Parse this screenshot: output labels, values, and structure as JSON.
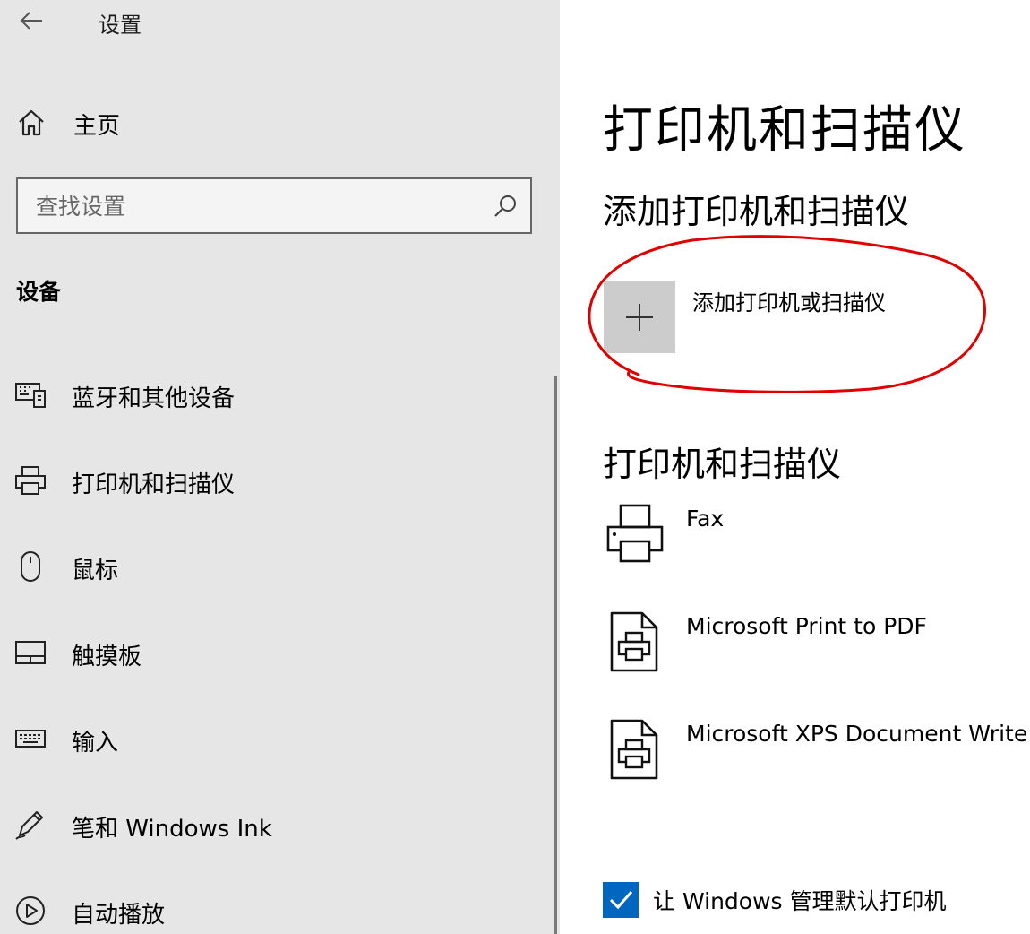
{
  "window": {
    "title": "设置"
  },
  "sidebar": {
    "home_label": "主页",
    "search_placeholder": "查找设置",
    "section_title": "设备",
    "items": [
      {
        "label": "蓝牙和其他设备",
        "icon": "bluetooth-devices-icon"
      },
      {
        "label": "打印机和扫描仪",
        "icon": "printer-icon"
      },
      {
        "label": "鼠标",
        "icon": "mouse-icon"
      },
      {
        "label": "触摸板",
        "icon": "touchpad-icon"
      },
      {
        "label": "输入",
        "icon": "keyboard-icon"
      },
      {
        "label": "笔和 Windows Ink",
        "icon": "pen-icon"
      },
      {
        "label": "自动播放",
        "icon": "autoplay-icon"
      }
    ]
  },
  "main": {
    "page_title": "打印机和扫描仪",
    "add_section_title": "添加打印机和扫描仪",
    "add_button_label": "添加打印机或扫描仪",
    "printers_section_title": "打印机和扫描仪",
    "printers": [
      {
        "name": "Fax",
        "icon": "fax-printer-icon"
      },
      {
        "name": "Microsoft Print to PDF",
        "icon": "document-printer-icon"
      },
      {
        "name": "Microsoft XPS Document Write",
        "icon": "document-printer-icon"
      }
    ],
    "manage_default_label": "让 Windows 管理默认打印机",
    "manage_default_checked": true
  },
  "colors": {
    "sidebar_bg": "#e6e6e6",
    "accent": "#0067c0",
    "annotation_red": "#e00000",
    "tile_bg": "#cccccc"
  }
}
